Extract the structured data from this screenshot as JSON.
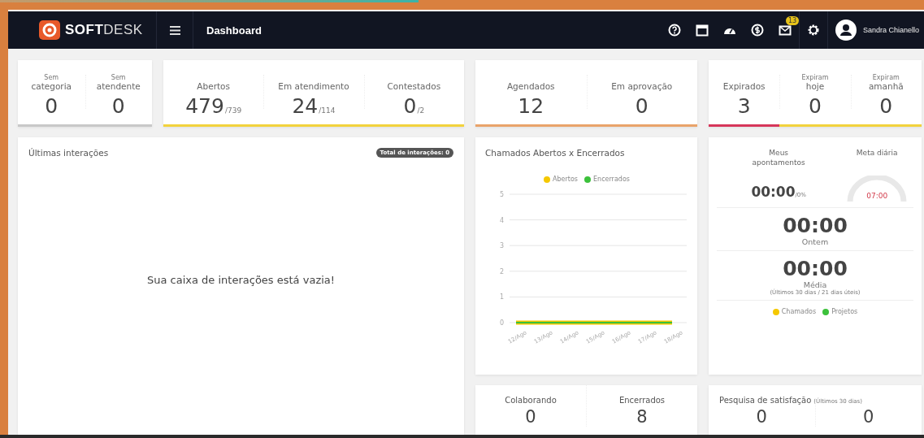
{
  "navbar": {
    "brand_bold": "SOFT",
    "brand_light": "DESK",
    "page_title": "Dashboard",
    "mail_badge": "13",
    "user_name": "Sandra Chianello"
  },
  "summary_cards": [
    {
      "stats": [
        {
          "label_small": "Sem",
          "label": "categoria",
          "value": "0",
          "color": "#c8c8c8"
        },
        {
          "label_small": "Sem",
          "label": "atendente",
          "value": "0",
          "color": "#c8c8c8"
        }
      ]
    },
    {
      "stats": [
        {
          "label": "Abertos",
          "value": "479",
          "total": "/739",
          "color": "#f2d23c"
        },
        {
          "label": "Em atendimento",
          "value": "24",
          "total": "/114",
          "color": "#f2d23c"
        },
        {
          "label": "Contestados",
          "value": "0",
          "total": "/2",
          "color": "#f2d23c"
        }
      ]
    },
    {
      "stats": [
        {
          "label": "Agendados",
          "value": "12",
          "color": "#e9a36a"
        },
        {
          "label": "Em aprovação",
          "value": "0",
          "color": "#e9a36a"
        }
      ]
    },
    {
      "stats": [
        {
          "label": "Expirados",
          "value": "3",
          "color": "#d6365a"
        },
        {
          "label_small": "Expiram",
          "label": "hoje",
          "value": "0",
          "color": "#f2d23c"
        },
        {
          "label_small": "Expiram",
          "label": "amanhã",
          "value": "0",
          "color": "#f2d23c"
        }
      ]
    }
  ],
  "interactions": {
    "title": "Últimas interações",
    "total_badge": "Total de interações: 0",
    "empty_message": "Sua caixa de interações está vazia!"
  },
  "tickets_chart": {
    "title": "Chamados Abertos x Encerrados",
    "chart_data": {
      "type": "line",
      "categories": [
        "12/Ago",
        "13/Ago",
        "14/Ago",
        "15/Ago",
        "16/Ago",
        "17/Ago",
        "18/Ago"
      ],
      "ylim": [
        0,
        5
      ],
      "grid": true,
      "yticks": [
        0,
        1,
        2,
        3,
        4,
        5
      ],
      "series": [
        {
          "name": "Abertos",
          "color": "#f5c800",
          "values": [
            0,
            0,
            0,
            0,
            0,
            0,
            0
          ]
        },
        {
          "name": "Encerrados",
          "color": "#3cc13b",
          "values": [
            0,
            0,
            0,
            0,
            0,
            0,
            0
          ]
        }
      ]
    }
  },
  "time_card": {
    "my_label": "Meus apontamentos",
    "my_value": "00:00",
    "my_percent": "/0%",
    "goal_label": "Meta diária",
    "goal_value": "07:00",
    "yesterday_value": "00:00",
    "yesterday_label": "Ontem",
    "average_value": "00:00",
    "average_label": "Média",
    "average_note": "(Últimos 30 dias / 21 dias úteis)",
    "legend": [
      {
        "label": "Chamados",
        "color": "#f5c800"
      },
      {
        "label": "Projetos",
        "color": "#3cc13b"
      }
    ]
  },
  "status_card": {
    "stats": [
      {
        "label": "Colaborando",
        "value": "0"
      },
      {
        "label": "Encerrados",
        "value": "8"
      }
    ]
  },
  "satisfaction_card": {
    "title": "Pesquisa de satisfação",
    "note": "(Últimos 30 dias)",
    "values": [
      "0",
      "0"
    ]
  }
}
